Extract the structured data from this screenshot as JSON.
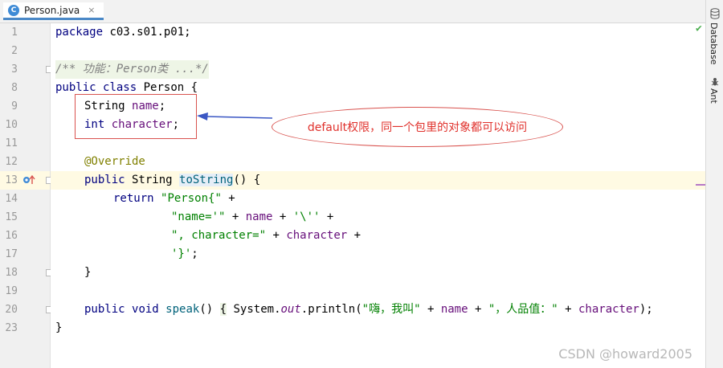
{
  "tab": {
    "icon_letter": "C",
    "title": "Person.java",
    "close": "×"
  },
  "rightbar": {
    "database": "Database",
    "ant": "Ant"
  },
  "line_numbers": [
    "1",
    "2",
    "3",
    "8",
    "9",
    "10",
    "11",
    "12",
    "13",
    "14",
    "15",
    "16",
    "17",
    "18",
    "19",
    "20",
    "23"
  ],
  "code": {
    "l1_kw": "package",
    "l1_rest": " c03.s01.p01;",
    "l3": "/** 功能：Person类 ...*/",
    "l8_kw1": "public",
    "l8_kw2": "class",
    "l8_rest": " Person {",
    "l9_type": "String",
    "l9_field": "name",
    "l9_end": ";",
    "l10_type": "int",
    "l10_field": "character",
    "l10_end": ";",
    "l12": "@Override",
    "l13_kw": "public",
    "l13_type": " String ",
    "l13_method": "toString",
    "l13_end": "() {",
    "l14_kw": "return",
    "l14_str": "\"Person{\"",
    "l14_end": " +",
    "l15_str": "\"name='\"",
    "l15_op": " + ",
    "l15_field": "name",
    "l15_op2": " + ",
    "l15_str2": "'\\''",
    "l15_end": " +",
    "l16_str": "\", character=\"",
    "l16_op": " + ",
    "l16_field": "character",
    "l16_end": " +",
    "l17_str": "'}'",
    "l17_end": ";",
    "l18": "}",
    "l19": "",
    "l20_kw1": "public",
    "l20_kw2": "void",
    "l20_method": "speak",
    "l20_p": "() ",
    "l20_brace": "{",
    "l20_sys": " System.",
    "l20_out": "out",
    "l20_call": ".println(",
    "l20_str1": "\"嗨，我叫\"",
    "l20_op1": " + ",
    "l20_f1": "name",
    "l20_op2": " + ",
    "l20_str2": "\"，人品值：\"",
    "l20_op3": " + ",
    "l20_f2": "character",
    "l20_end": ");",
    "l23": "}"
  },
  "annotation": {
    "callout_text": "default权限，同一个包里的对象都可以访问"
  },
  "watermark": "CSDN @howard2005",
  "colors": {
    "keyword": "#000080",
    "string": "#008000",
    "field": "#660e7a",
    "annotation": "#808000",
    "callout": "#e0302b"
  }
}
